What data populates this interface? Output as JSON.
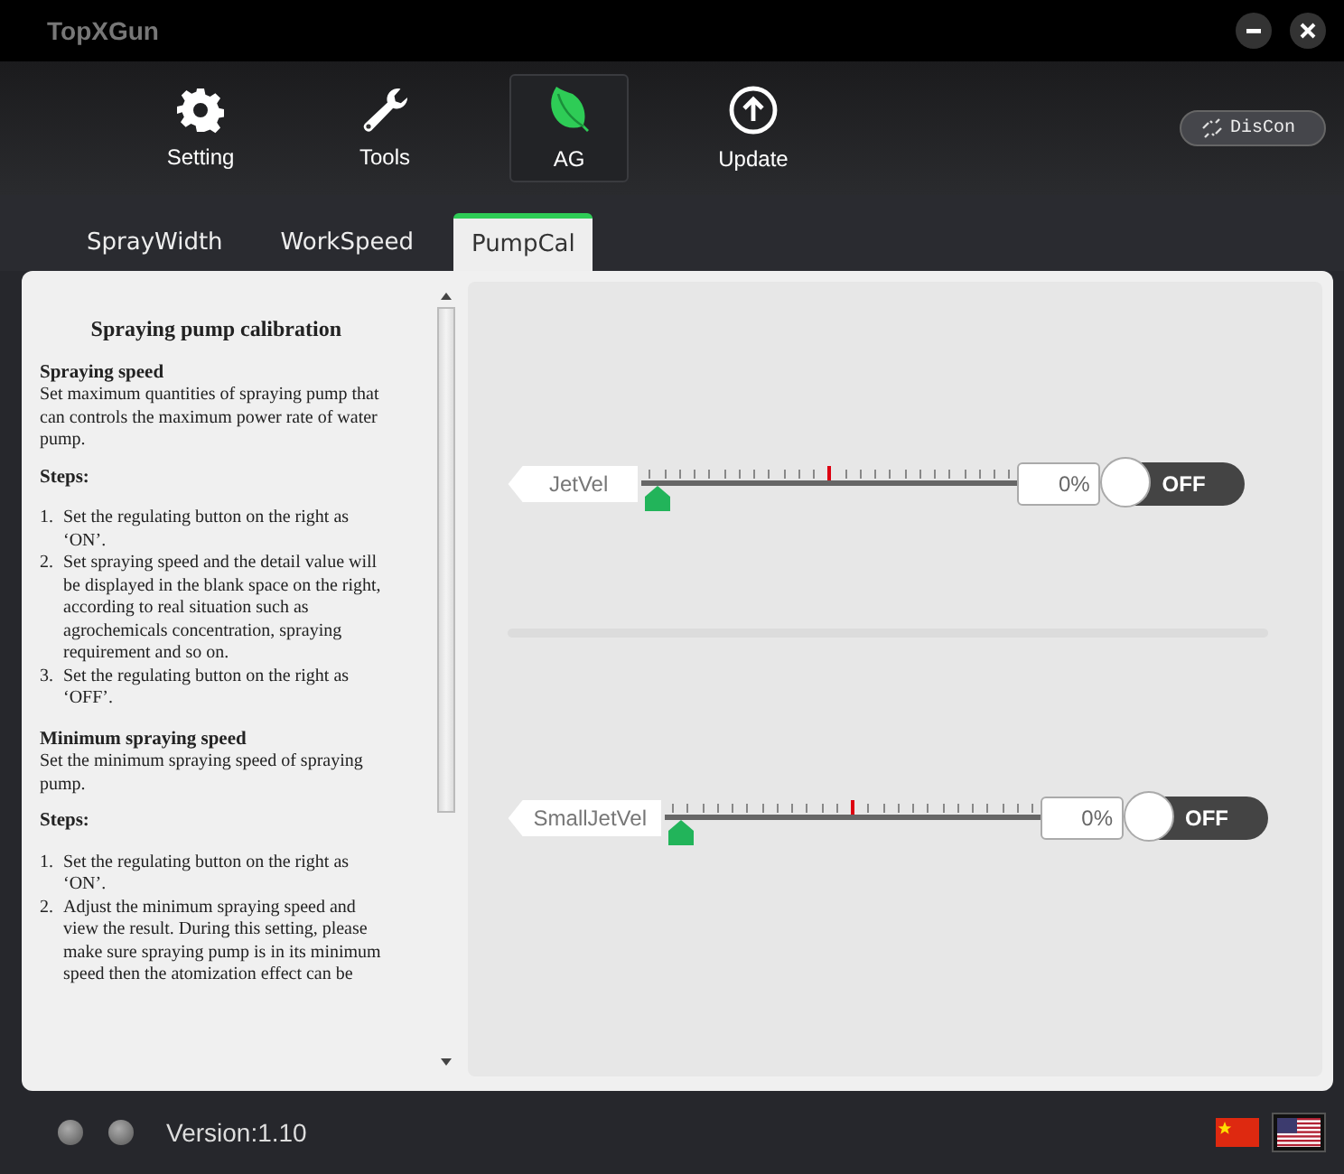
{
  "window": {
    "title": "TopXGun"
  },
  "nav": [
    {
      "label": "Setting",
      "selected": false
    },
    {
      "label": "Tools",
      "selected": false
    },
    {
      "label": "AG",
      "selected": true
    },
    {
      "label": "Update",
      "selected": false
    }
  ],
  "connection_button": {
    "label": "DisCon"
  },
  "tabs": [
    {
      "label": "SprayWidth",
      "selected": false
    },
    {
      "label": "WorkSpeed",
      "selected": false
    },
    {
      "label": "PumpCal",
      "selected": true
    }
  ],
  "help": {
    "title": "Spraying pump calibration",
    "sections": [
      {
        "heading": "Spraying speed",
        "text": "Set maximum quantities of spraying pump that can controls the maximum power rate of water pump.",
        "steps_title": "Steps:",
        "steps": [
          {
            "number": "1.",
            "text": "Set the regulating button on the right as ‘ON’."
          },
          {
            "number": "2.",
            "text": "Set spraying speed and the detail value will be displayed in the blank space on the right, according to real situation such as agrochemicals concentration, spraying requirement and so on."
          },
          {
            "number": "3.",
            "text": "Set the regulating button on the right as ‘OFF’."
          }
        ]
      },
      {
        "heading": "Minimum spraying speed",
        "text": "Set the minimum spraying speed of spraying pump.",
        "steps_title": "Steps:",
        "steps": [
          {
            "number": "1.",
            "text": "Set the regulating button on the right as ‘ON’."
          },
          {
            "number": "2.",
            "text": "Adjust the minimum spraying speed and view the result. During this setting, please make sure spraying pump is in its minimum speed then the atomization effect can be"
          }
        ]
      }
    ]
  },
  "channels": [
    {
      "name": "JetVel",
      "level": 0,
      "reading": "0%",
      "on": false,
      "switch_label": "OFF"
    },
    {
      "name": "SmallJetVel",
      "level": 0,
      "reading": "0%",
      "on": false,
      "switch_label": "OFF"
    }
  ],
  "status_bar": {
    "leds": [
      {
        "on": false
      },
      {
        "on": false
      }
    ],
    "version": "Version:1.10",
    "languages": [
      {
        "selected": false
      },
      {
        "selected": true
      }
    ]
  }
}
